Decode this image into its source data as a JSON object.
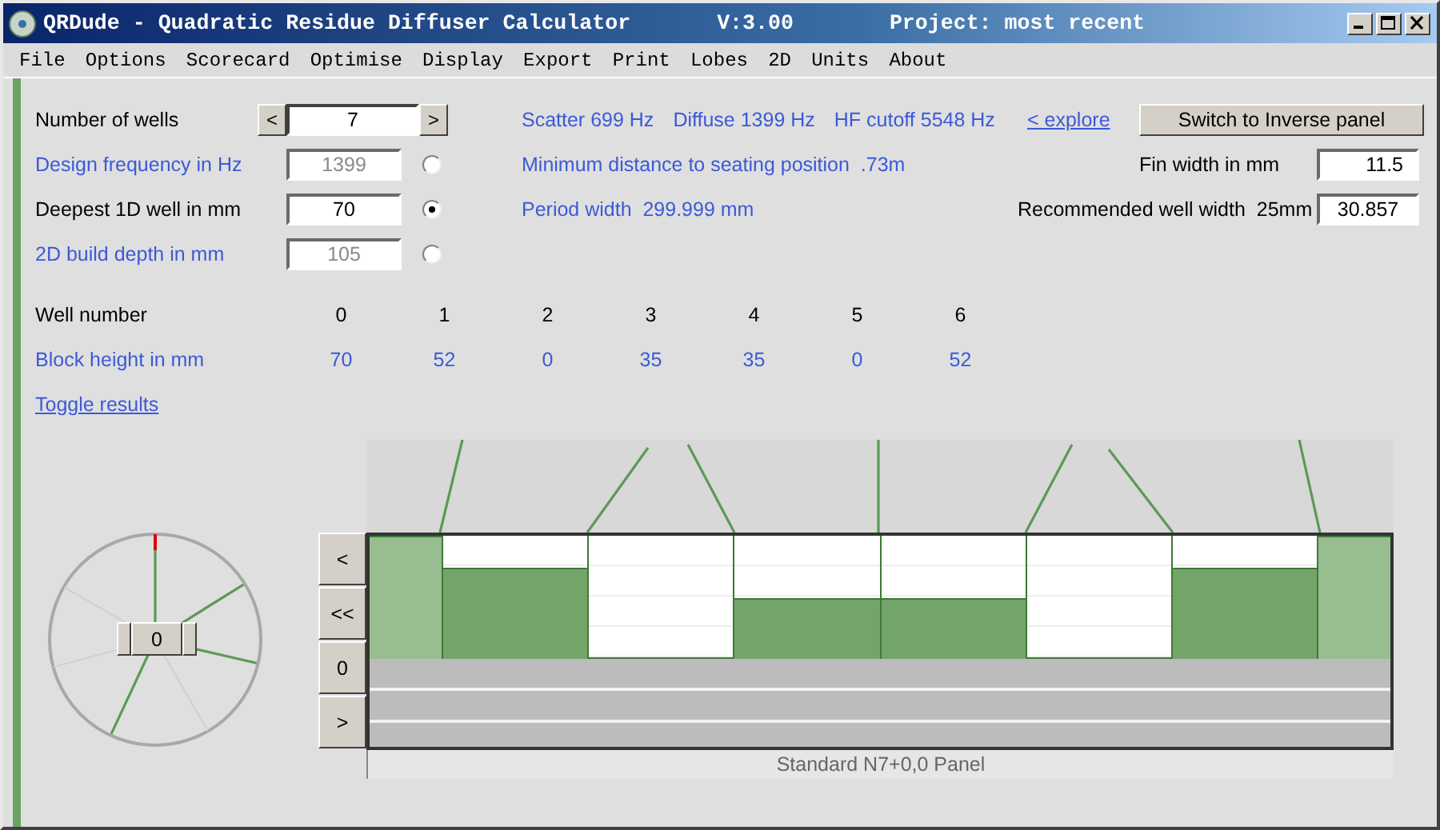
{
  "window": {
    "title": "QRDude - Quadratic Residue Diffuser Calculator",
    "version": "V:3.00",
    "project": "Project: most recent"
  },
  "menu": [
    "File",
    "Options",
    "Scorecard",
    "Optimise",
    "Display",
    "Export",
    "Print",
    "Lobes",
    "2D",
    "Units",
    "About"
  ],
  "settings": [
    {
      "kind": "spinner",
      "label": "Number of wells",
      "value": "7",
      "prev": "<",
      "next": ">"
    },
    {
      "kind": "radio",
      "label": "Design frequency in Hz",
      "value": "1399",
      "selected": false
    },
    {
      "kind": "radio",
      "label": "Deepest 1D well in mm",
      "value": "70",
      "selected": true
    },
    {
      "kind": "radio",
      "label": "2D build depth in mm",
      "value": "105",
      "selected": false
    }
  ],
  "results": [
    [
      "Scatter 699 Hz",
      "Diffuse 1399 Hz",
      "HF cutoff 5548 Hz"
    ],
    [
      "Minimum distance to seating position  .73m"
    ],
    [
      "Period width  299.999 mm"
    ]
  ],
  "explore_link": "< explore",
  "switch_button": "Switch to Inverse panel",
  "fin_width": {
    "label": "Fin width in mm",
    "value": "11.5"
  },
  "well_width": {
    "label": "Recommended well width  25mm",
    "value": "30.857"
  },
  "wells": {
    "number_label": "Well number",
    "height_label": "Block height in mm",
    "numbers": [
      "0",
      "1",
      "2",
      "3",
      "4",
      "5",
      "6"
    ],
    "heights": [
      "70",
      "52",
      "0",
      "35",
      "35",
      "0",
      "52"
    ]
  },
  "toggle_link": "Toggle results",
  "dial": {
    "value": "0"
  },
  "side_buttons": [
    "<",
    "<<",
    "0",
    ">"
  ],
  "panel": {
    "caption": "Standard N7+0,0 Panel"
  }
}
